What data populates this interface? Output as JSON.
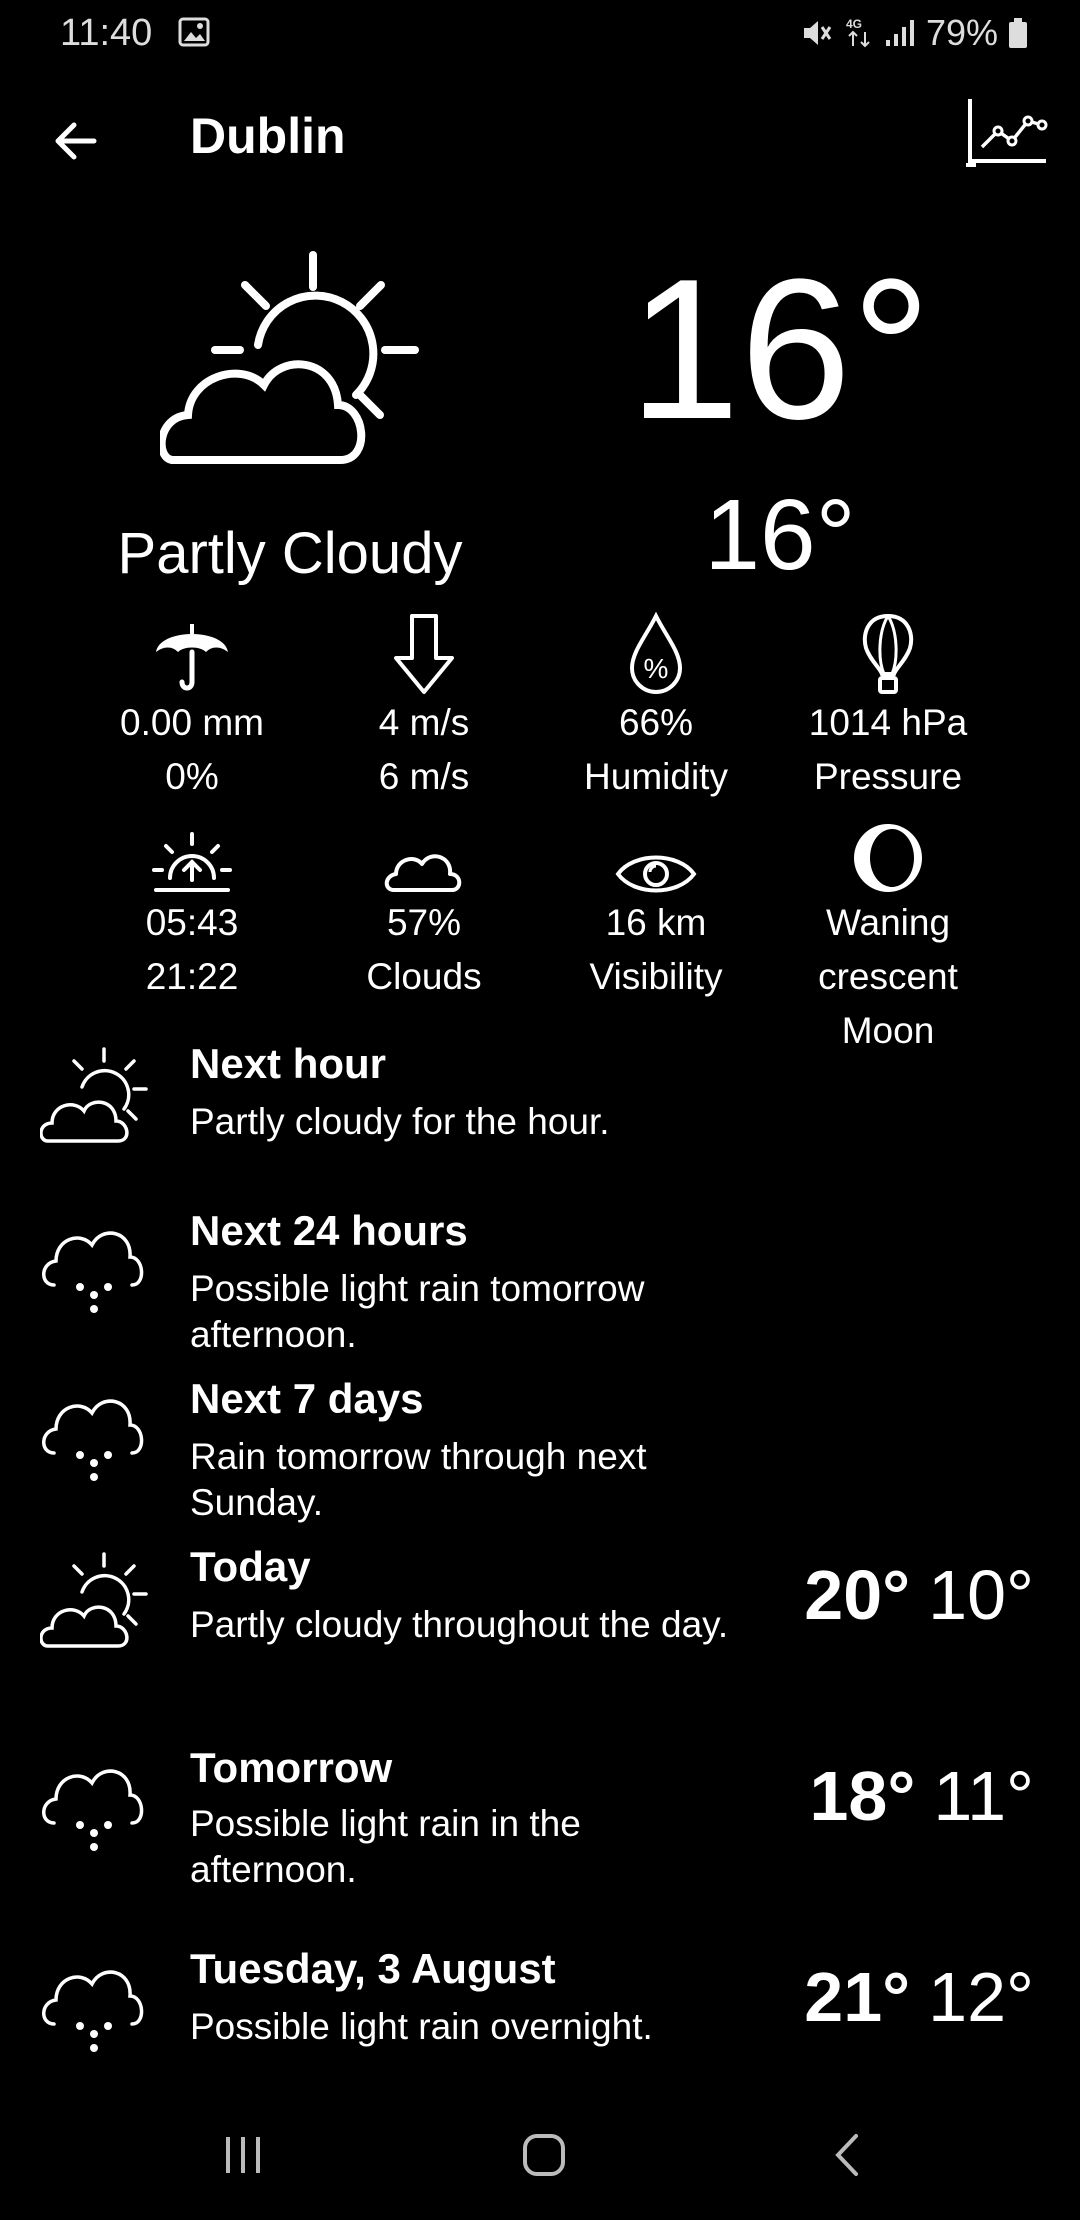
{
  "status": {
    "time": "11:40",
    "battery": "79%"
  },
  "header": {
    "title": "Dublin"
  },
  "current": {
    "temp": "16°",
    "feels_like": "16°",
    "summary": "Partly Cloudy"
  },
  "details": [
    {
      "icon": "umbrella-icon",
      "line1": "0.00 mm",
      "line2": "0%"
    },
    {
      "icon": "wind-arrow-icon",
      "line1": "4 m/s",
      "line2": "6 m/s"
    },
    {
      "icon": "humidity-drop-icon",
      "line1": "66%",
      "line2": "Humidity"
    },
    {
      "icon": "balloon-icon",
      "line1": "1014 hPa",
      "line2": "Pressure"
    },
    {
      "icon": "sunrise-icon",
      "line1": "05:43",
      "line2": "21:22"
    },
    {
      "icon": "cloud-icon",
      "line1": "57%",
      "line2": "Clouds"
    },
    {
      "icon": "eye-icon",
      "line1": "16 km",
      "line2": "Visibility"
    },
    {
      "icon": "moon-icon",
      "line1": "Waning crescent",
      "line2": "Moon"
    }
  ],
  "forecast": [
    {
      "icon": "partly-cloudy-icon",
      "title": "Next hour",
      "desc": "Partly cloudy for the hour.",
      "hi": "",
      "lo": ""
    },
    {
      "icon": "rain-cloud-icon",
      "title": "Next 24 hours",
      "desc": "Possible light rain tomorrow afternoon.",
      "hi": "",
      "lo": ""
    },
    {
      "icon": "rain-cloud-icon",
      "title": "Next 7 days",
      "desc": "Rain tomorrow through next Sunday.",
      "hi": "",
      "lo": ""
    },
    {
      "icon": "partly-cloudy-icon",
      "title": "Today",
      "desc": "Partly cloudy throughout the day.",
      "hi": "20°",
      "lo": "10°"
    },
    {
      "icon": "rain-cloud-icon",
      "title": "Tomorrow",
      "desc": "Possible light rain in the afternoon.",
      "hi": "18°",
      "lo": "11°"
    },
    {
      "icon": "rain-cloud-icon",
      "title": "Tuesday, 3 August",
      "desc": "Possible light rain overnight.",
      "hi": "21°",
      "lo": "12°"
    }
  ]
}
